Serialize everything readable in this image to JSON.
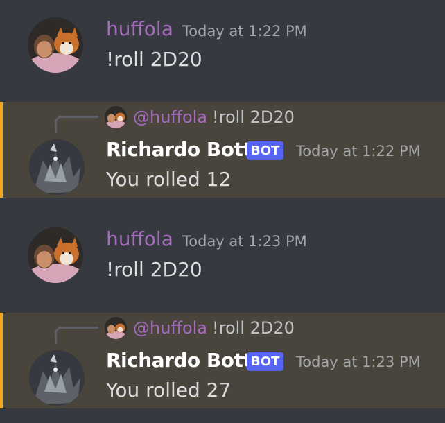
{
  "messages": [
    {
      "type": "user",
      "author": "huffola",
      "timestamp": "Today at 1:22 PM",
      "content": "!roll 2D20",
      "avatar_icon": "person-with-dog-avatar"
    },
    {
      "type": "bot",
      "author": "Richardo Botts",
      "badge": "BOT",
      "timestamp": "Today at 1:22 PM",
      "content": "You rolled 12",
      "avatar_icon": "dragon-avatar",
      "reply": {
        "mention": "@huffola",
        "text": "!roll 2D20",
        "avatar_icon": "person-with-dog-avatar"
      }
    },
    {
      "type": "user",
      "author": "huffola",
      "timestamp": "Today at 1:23 PM",
      "content": "!roll 2D20",
      "avatar_icon": "person-with-dog-avatar"
    },
    {
      "type": "bot",
      "author": "Richardo Botts",
      "badge": "BOT",
      "timestamp": "Today at 1:23 PM",
      "content": "You rolled 27",
      "avatar_icon": "dragon-avatar",
      "reply": {
        "mention": "@huffola",
        "text": "!roll 2D20",
        "avatar_icon": "person-with-dog-avatar"
      }
    }
  ],
  "colors": {
    "background": "#36393f",
    "highlight_background": "#49443c",
    "highlight_border": "#faa61a",
    "username_purple": "#a66bbd",
    "bot_badge": "#5865f2",
    "timestamp": "#a3a6aa"
  }
}
